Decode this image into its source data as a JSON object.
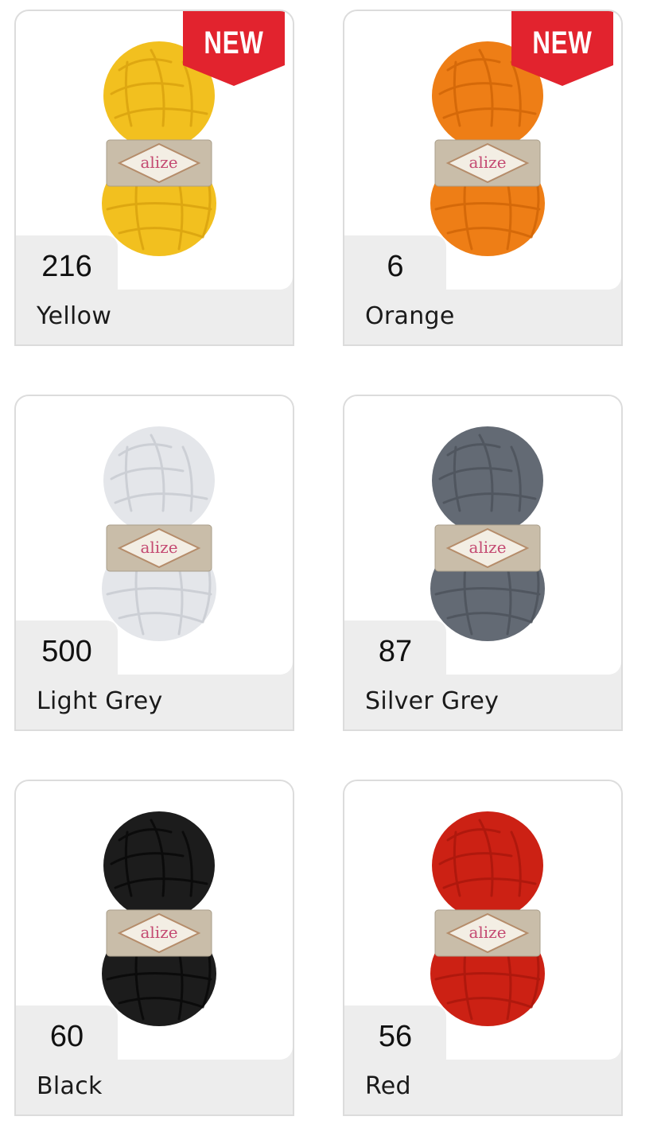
{
  "products": [
    {
      "number": "216",
      "name": "Yellow",
      "badge": "NEW",
      "yarn_color": "#f2c01f",
      "yarn_dark": "#d9a10e",
      "brand": "alize"
    },
    {
      "number": "6",
      "name": "Orange",
      "badge": "NEW",
      "yarn_color": "#ee7e16",
      "yarn_dark": "#cf6407",
      "brand": "alize"
    },
    {
      "number": "500",
      "name": "Light Grey",
      "badge": "",
      "yarn_color": "#e4e6ea",
      "yarn_dark": "#c7cad0",
      "brand": "alize"
    },
    {
      "number": "87",
      "name": "Silver Grey",
      "badge": "",
      "yarn_color": "#636a74",
      "yarn_dark": "#4c525b",
      "brand": "alize"
    },
    {
      "number": "60",
      "name": "Black",
      "badge": "",
      "yarn_color": "#1c1c1c",
      "yarn_dark": "#070707",
      "brand": "alize"
    },
    {
      "number": "56",
      "name": "Red",
      "badge": "",
      "yarn_color": "#cc2114",
      "yarn_dark": "#a8160c",
      "brand": "alize"
    }
  ],
  "colors": {
    "badge_red": "#e2232e",
    "label_band": "#c9bda9"
  }
}
